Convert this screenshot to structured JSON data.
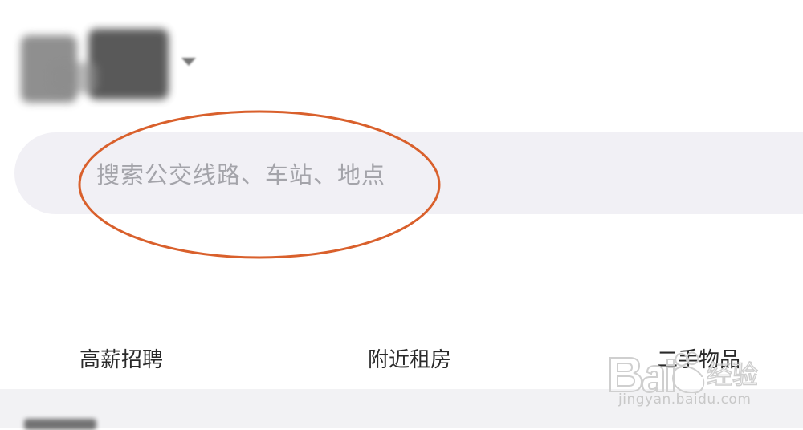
{
  "header": {
    "city_label": "长春",
    "city_caret_icon": "caret-down-icon"
  },
  "search": {
    "placeholder": "搜索公交线路、车站、地点"
  },
  "shortcuts": [
    {
      "label": "高薪招聘"
    },
    {
      "label": "附近租房"
    },
    {
      "label": "二手物品"
    }
  ],
  "watermark": {
    "text": "Baidu经验",
    "url": "jingyan.baidu.com"
  },
  "colors": {
    "search_bg": "#f1f0f5",
    "placeholder": "#a4a4aa",
    "highlight_ring": "#d9602c",
    "band_bg": "#f2f2f4"
  }
}
